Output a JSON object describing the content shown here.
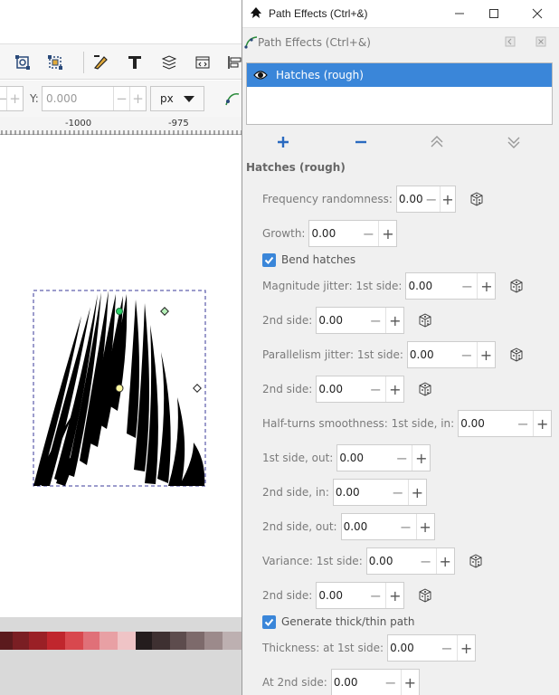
{
  "window": {
    "title": "Path Effects (Ctrl+&)",
    "subtitle": "Path Effects (Ctrl+&)"
  },
  "toolbar": {
    "y_label": "Y:",
    "y_value": "0.000",
    "unit": "px"
  },
  "ruler": {
    "labels": [
      "-1000",
      "-975"
    ]
  },
  "effects": {
    "items": [
      {
        "label": "Hatches (rough)",
        "visible": true
      }
    ]
  },
  "section_title": "Hatches (rough)",
  "params": {
    "frequency": {
      "label": "Frequency randomness:",
      "value": "0.00"
    },
    "growth": {
      "label": "Growth:",
      "value": "0.00"
    },
    "bend": {
      "label": "Bend hatches",
      "checked": true
    },
    "magnitude_1": {
      "label": "Magnitude jitter: 1st side:",
      "value": "0.00"
    },
    "magnitude_2": {
      "label": "2nd side:",
      "value": "0.00"
    },
    "parallel_1": {
      "label": "Parallelism jitter: 1st side:",
      "value": "0.00"
    },
    "parallel_2": {
      "label": "2nd side:",
      "value": "0.00"
    },
    "halfturn_1in": {
      "label": "Half-turns smoothness: 1st side, in:",
      "value": "0.00"
    },
    "halfturn_1out": {
      "label": "1st side, out:",
      "value": "0.00"
    },
    "halfturn_2in": {
      "label": "2nd side, in:",
      "value": "0.00"
    },
    "halfturn_2out": {
      "label": "2nd side, out:",
      "value": "0.00"
    },
    "variance_1": {
      "label": "Variance: 1st side:",
      "value": "0.00"
    },
    "variance_2": {
      "label": "2nd side:",
      "value": "0.00"
    },
    "generate": {
      "label": "Generate thick/thin path",
      "checked": true
    },
    "thickness_1": {
      "label": "Thickness: at 1st side:",
      "value": "0.00"
    },
    "thickness_2": {
      "label": "At 2nd side:",
      "value": "0.00"
    }
  },
  "palette": [
    "#5b1a1d",
    "#7a1e23",
    "#9a2026",
    "#c0262d",
    "#d8484e",
    "#e07078",
    "#e8a0a4",
    "#efc4c6",
    "#241c1d",
    "#3e3031",
    "#5d4c4d",
    "#7d6a6b",
    "#9c8a8b",
    "#bdb0b1"
  ],
  "colors": {
    "accent": "#3a86d9",
    "dialog_bg": "#f0f0f0"
  }
}
